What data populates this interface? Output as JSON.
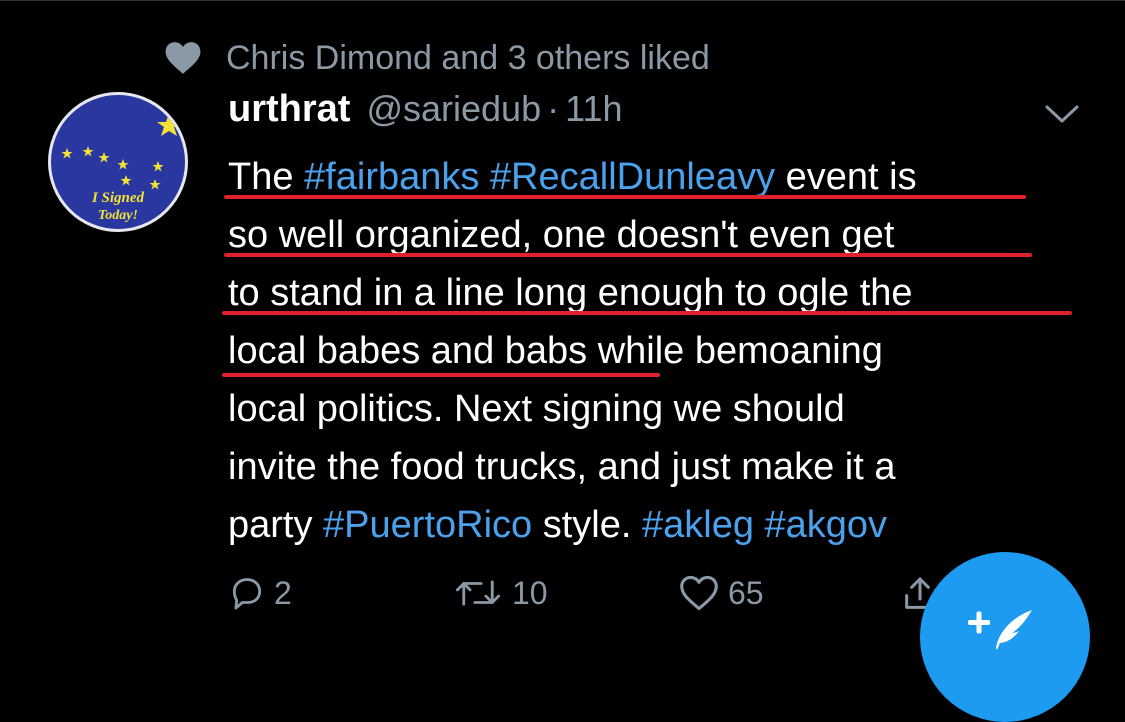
{
  "social_context": {
    "text": "Chris Dimond and 3 others liked",
    "icon": "heart-icon"
  },
  "tweet": {
    "display_name": "urthrat",
    "handle": "@sariedub",
    "separator": "·",
    "time": "11h",
    "avatar": {
      "line1": "I Signed",
      "line2": "Today!"
    },
    "text_lines": [
      [
        {
          "t": "The ",
          "tag": false
        },
        {
          "t": "#fairbanks #RecallDunleavy",
          "tag": true
        },
        {
          "t": " event is",
          "tag": false
        }
      ],
      [
        {
          "t": "so well organized, one doesn't even get",
          "tag": false
        }
      ],
      [
        {
          "t": "to stand in a line long enough to ogle the",
          "tag": false
        }
      ],
      [
        {
          "t": "local babes and babs while bemoaning",
          "tag": false
        }
      ],
      [
        {
          "t": "local politics. Next signing we should",
          "tag": false
        }
      ],
      [
        {
          "t": "invite the food trucks, and just make it a",
          "tag": false
        }
      ],
      [
        {
          "t": "party ",
          "tag": false
        },
        {
          "t": "#PuertoRico",
          "tag": true
        },
        {
          "t": " style. ",
          "tag": false
        },
        {
          "t": "#akleg #akgov",
          "tag": true
        }
      ]
    ],
    "actions": {
      "reply_count": "2",
      "retweet_count": "10",
      "like_count": "65"
    }
  },
  "colors": {
    "background": "#000000",
    "muted": "#8b98a5",
    "hashtag": "#4ba1ec",
    "annotation": "#e0202b",
    "fab": "#1d9bf0"
  },
  "fab": {
    "icon": "compose-tweet-icon"
  }
}
